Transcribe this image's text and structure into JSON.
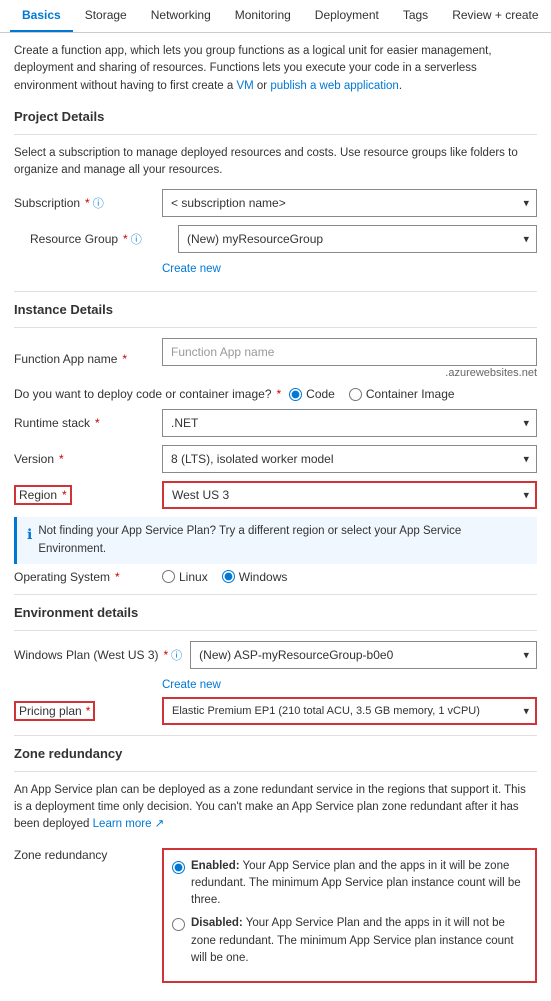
{
  "tabs": [
    {
      "id": "basics",
      "label": "Basics",
      "active": true
    },
    {
      "id": "storage",
      "label": "Storage",
      "active": false
    },
    {
      "id": "networking",
      "label": "Networking",
      "active": false
    },
    {
      "id": "monitoring",
      "label": "Monitoring",
      "active": false
    },
    {
      "id": "deployment",
      "label": "Deployment",
      "active": false
    },
    {
      "id": "tags",
      "label": "Tags",
      "active": false
    },
    {
      "id": "review",
      "label": "Review + create",
      "active": false
    }
  ],
  "intro": "Create a function app, which lets you group functions as a logical unit for easier management, deployment and sharing of resources. Functions lets you execute your code in a serverless environment without having to first create a VM or publish a web application.",
  "intro_links": [
    "VM",
    "web application"
  ],
  "sections": {
    "project_details": {
      "title": "Project Details",
      "desc": "Select a subscription to manage deployed resources and costs. Use resource groups like folders to organize and manage all your resources."
    },
    "instance_details": {
      "title": "Instance Details"
    },
    "environment_details": {
      "title": "Environment details"
    },
    "zone_redundancy": {
      "title": "Zone redundancy",
      "desc": "An App Service plan can be deployed as a zone redundant service in the regions that support it. This is a deployment time only decision. You can't make an App Service plan zone redundant after it has been deployed"
    }
  },
  "fields": {
    "subscription": {
      "label": "Subscription",
      "required": true,
      "value": "< subscription name>"
    },
    "resource_group": {
      "label": "Resource Group",
      "required": true,
      "value": "(New) myResourceGroup",
      "create_new": "Create new"
    },
    "function_app_name": {
      "label": "Function App name",
      "required": true,
      "placeholder": "Function App name",
      "suffix": ".azurewebsites.net"
    },
    "deploy_code": {
      "label": "Do you want to deploy code or container image?",
      "required": true,
      "options": [
        "Code",
        "Container Image"
      ],
      "selected": "Code"
    },
    "runtime_stack": {
      "label": "Runtime stack",
      "required": true,
      "value": ".NET"
    },
    "version": {
      "label": "Version",
      "required": true,
      "value": "8 (LTS), isolated worker model"
    },
    "region": {
      "label": "Region",
      "required": true,
      "value": "West US 3",
      "highlighted": true
    },
    "region_info": "Not finding your App Service Plan? Try a different region or select your App Service Environment.",
    "operating_system": {
      "label": "Operating System",
      "required": true,
      "options": [
        "Linux",
        "Windows"
      ],
      "selected": "Windows"
    },
    "windows_plan": {
      "label": "Windows Plan (West US 3)",
      "required": true,
      "value": "(New) ASP-myResourceGroup-b0e0",
      "create_new": "Create new"
    },
    "pricing_plan": {
      "label": "Pricing plan",
      "required": true,
      "value": "Elastic Premium EP1 (210 total ACU, 3.5 GB memory, 1 vCPU)",
      "highlighted": true
    },
    "zone_redundancy": {
      "options": [
        {
          "value": "enabled",
          "selected": true,
          "label": "Enabled:",
          "desc": "Your App Service plan and the apps in it will be zone redundant. The minimum App Service plan instance count will be three."
        },
        {
          "value": "disabled",
          "selected": false,
          "label": "Disabled:",
          "desc": "Your App Service Plan and the apps in it will not be zone redundant. The minimum App Service plan instance count will be one."
        }
      ]
    }
  },
  "links": {
    "learn_more": "Learn more"
  }
}
